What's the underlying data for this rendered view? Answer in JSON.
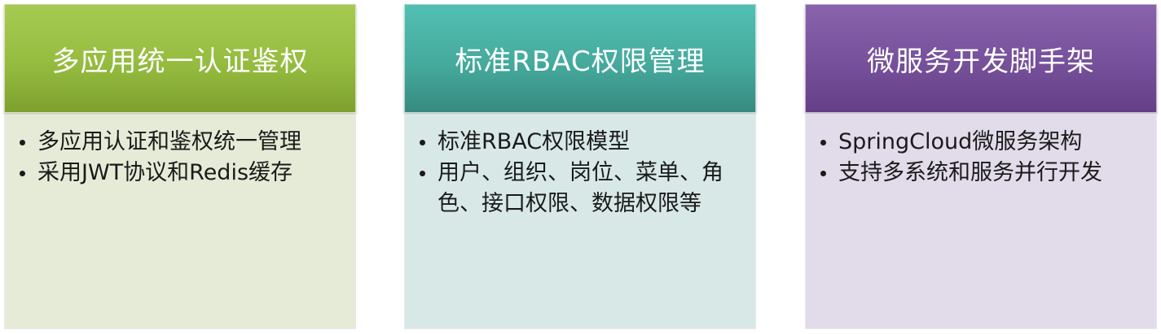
{
  "cards": [
    {
      "title": "多应用统一认证鉴权",
      "color": "#95bc3f",
      "items": [
        "多应用认证和鉴权统一管理",
        "采用JWT协议和Redis缓存"
      ]
    },
    {
      "title": "标准RBAC权限管理",
      "color": "#45aa9d",
      "items": [
        "标准RBAC权限模型",
        "用户、组织、岗位、菜单、角色、接口权限、数据权限等"
      ]
    },
    {
      "title": "微服务开发脚手架",
      "color": "#76509a",
      "items": [
        "SpringCloud微服务架构",
        "支持多系统和服务并行开发"
      ]
    }
  ]
}
